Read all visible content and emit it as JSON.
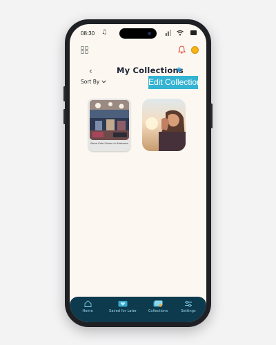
{
  "status_bar": {
    "time": "08:30"
  },
  "header": {
    "title": "My Collections",
    "sort_label": "Sort By",
    "edit_button_label": "Edit Collection"
  },
  "collections": [
    {
      "caption": "Rene Sale Fixxer in Alabama"
    },
    {
      "caption": ""
    }
  ],
  "tabs": [
    {
      "label": "Home",
      "icon": "home-icon"
    },
    {
      "label": "Saved for Later",
      "icon": "heart-tag-icon"
    },
    {
      "label": "Collections",
      "icon": "collections-icon"
    },
    {
      "label": "Settings",
      "icon": "sliders-icon"
    }
  ],
  "colors": {
    "accent": "#34b3d3",
    "tab_bar": "#0e3a4e",
    "background": "#fcf8f1"
  }
}
